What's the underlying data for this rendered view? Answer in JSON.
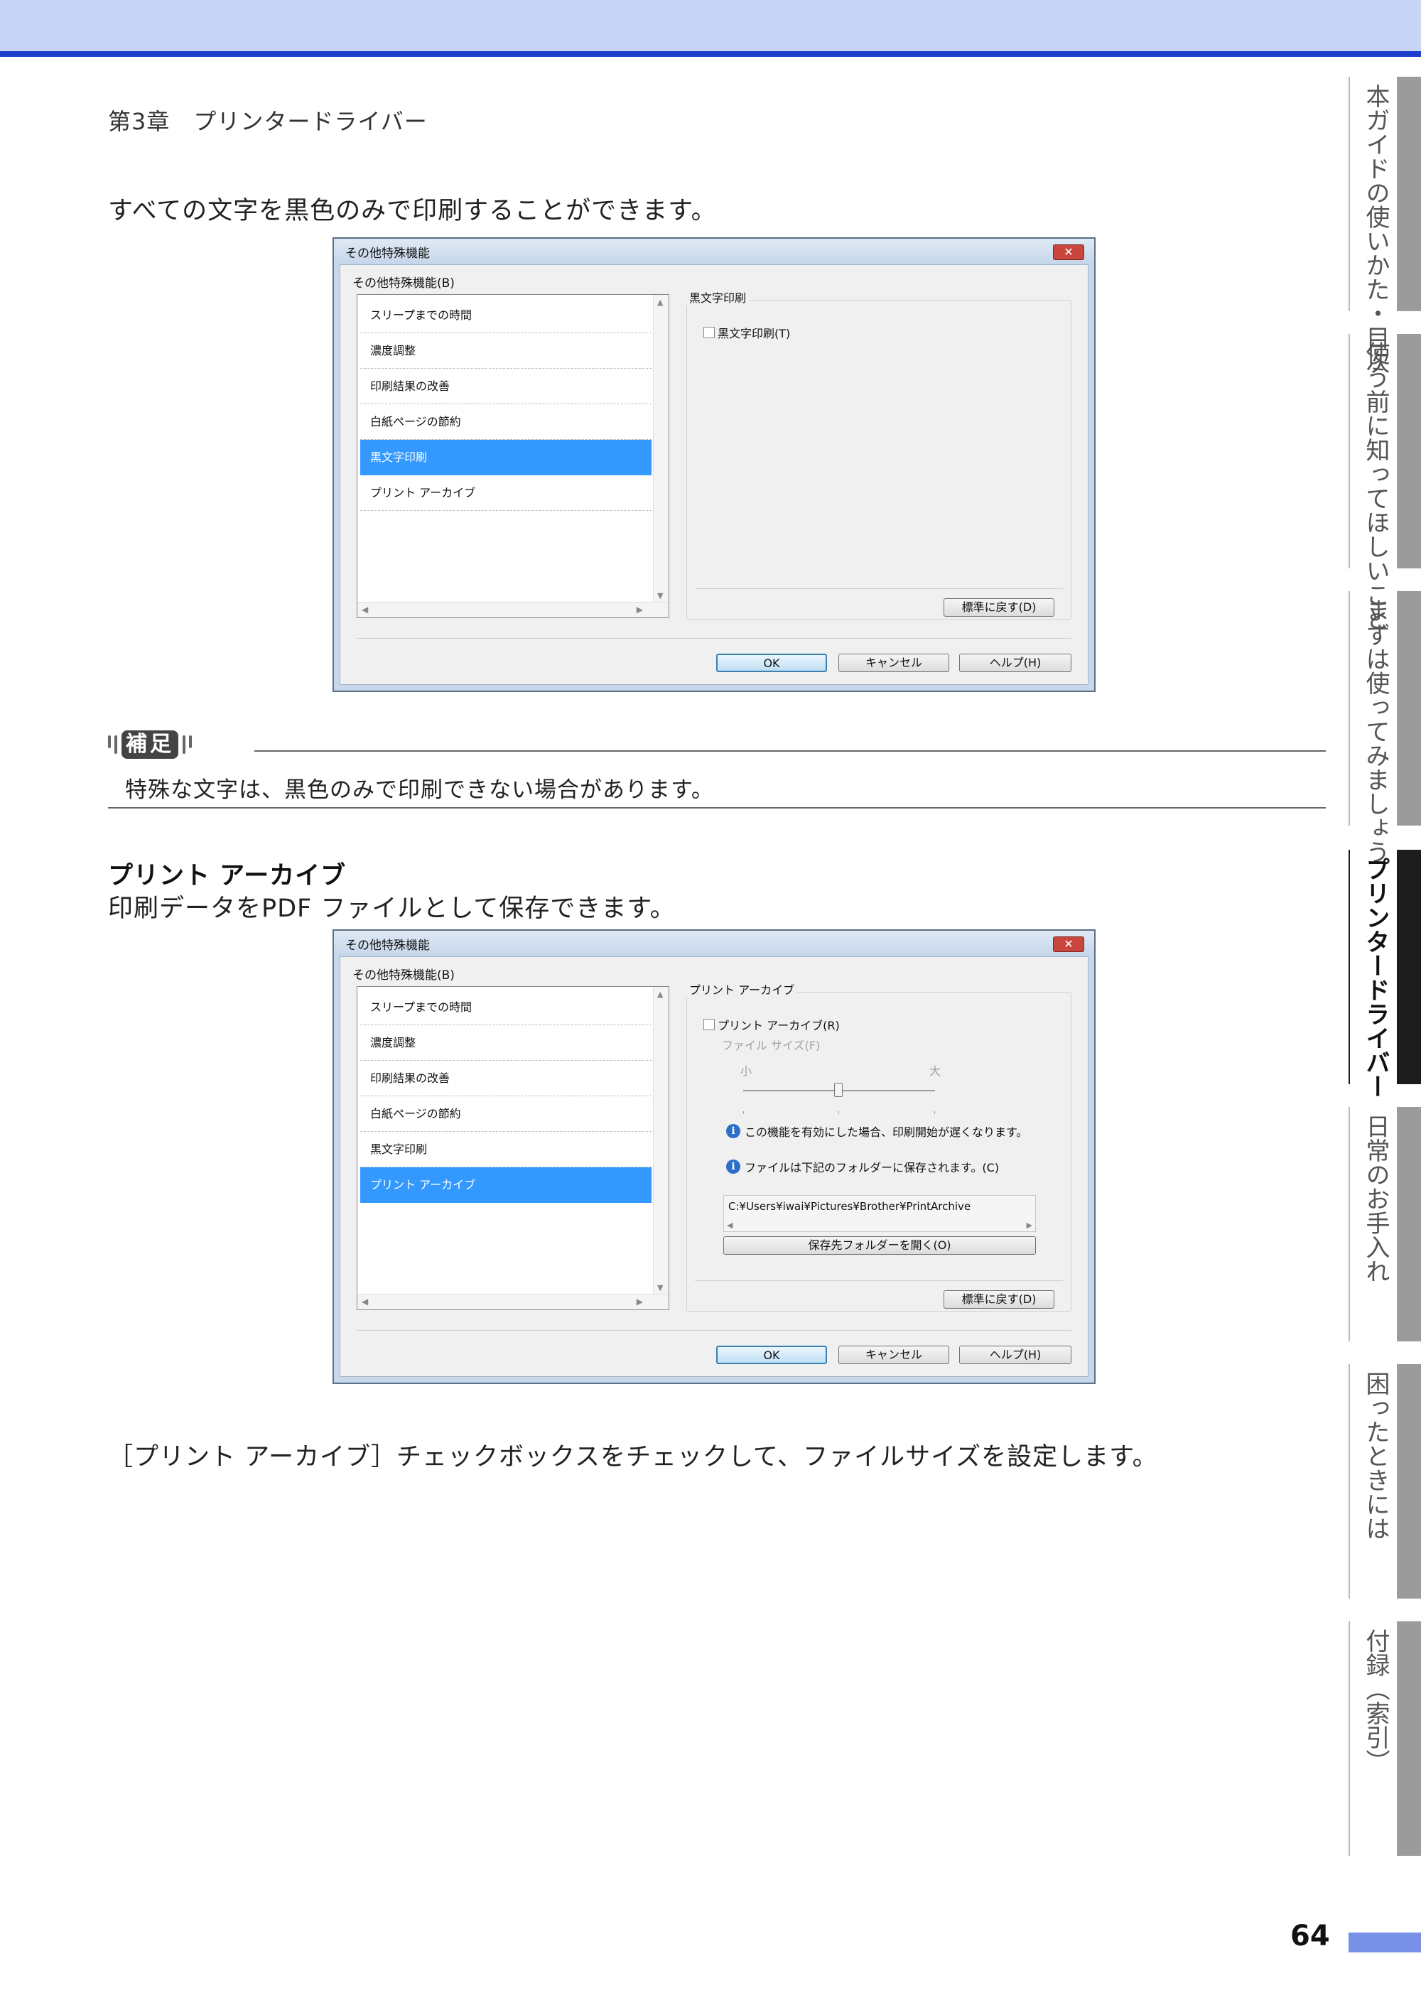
{
  "header": {
    "chapter": "第3章　プリンタードライバー"
  },
  "intro_text": "すべての文字を黒色のみで印刷することができます。",
  "dialog1": {
    "title": "その他特殊機能",
    "close": "✕",
    "group_label": "その他特殊機能(B)",
    "items": [
      "スリープまでの時間",
      "濃度調整",
      "印刷結果の改善",
      "白紙ページの節約",
      "黒文字印刷",
      "プリント アーカイブ"
    ],
    "right_group_label": "黒文字印刷",
    "checkbox_label": "黒文字印刷(T)",
    "reset_button": "標準に戻す(D)",
    "ok_button": "OK",
    "cancel_button": "キャンセル",
    "help_button": "ヘルプ(H)"
  },
  "note": {
    "label": "補足",
    "text": "特殊な文字は、黒色のみで印刷できない場合があります。"
  },
  "section": {
    "heading": "プリント アーカイブ",
    "subtext": "印刷データをPDF ファイルとして保存できます。"
  },
  "dialog2": {
    "title": "その他特殊機能",
    "close": "✕",
    "group_label": "その他特殊機能(B)",
    "items": [
      "スリープまでの時間",
      "濃度調整",
      "印刷結果の改善",
      "白紙ページの節約",
      "黒文字印刷",
      "プリント アーカイブ"
    ],
    "right_group_label": "プリント アーカイブ",
    "checkbox_label": "プリント アーカイブ(R)",
    "file_size_label": "ファイル サイズ(F)",
    "slider_small": "小",
    "slider_large": "大",
    "slider_level": 0.5,
    "info1": "この機能を有効にした場合、印刷開始が遅くなります。",
    "info2": "ファイルは下記のフォルダーに保存されます。(C)",
    "path": "C:¥Users¥iwai¥Pictures¥Brother¥PrintArchive",
    "open_folder_button": "保存先フォルダーを開く(O)",
    "reset_button": "標準に戻す(D)",
    "ok_button": "OK",
    "cancel_button": "キャンセル",
    "help_button": "ヘルプ(H)"
  },
  "closing_text": "［プリント アーカイブ］チェックボックスをチェックして、ファイルサイズを設定します。",
  "side_tabs": [
    "本ガイドの使いかた・目次",
    "使う前に知ってほしいこと",
    "まずは使ってみましょう",
    "プリンタードライバー",
    "日常のお手入れ",
    "困ったときには",
    "付録（索引）"
  ],
  "page_number": "64",
  "colors": {
    "accent": "#1d3fc9",
    "header_band": "#c9d5f7",
    "selection": "#3399ff",
    "page_bar": "#7891e6"
  }
}
